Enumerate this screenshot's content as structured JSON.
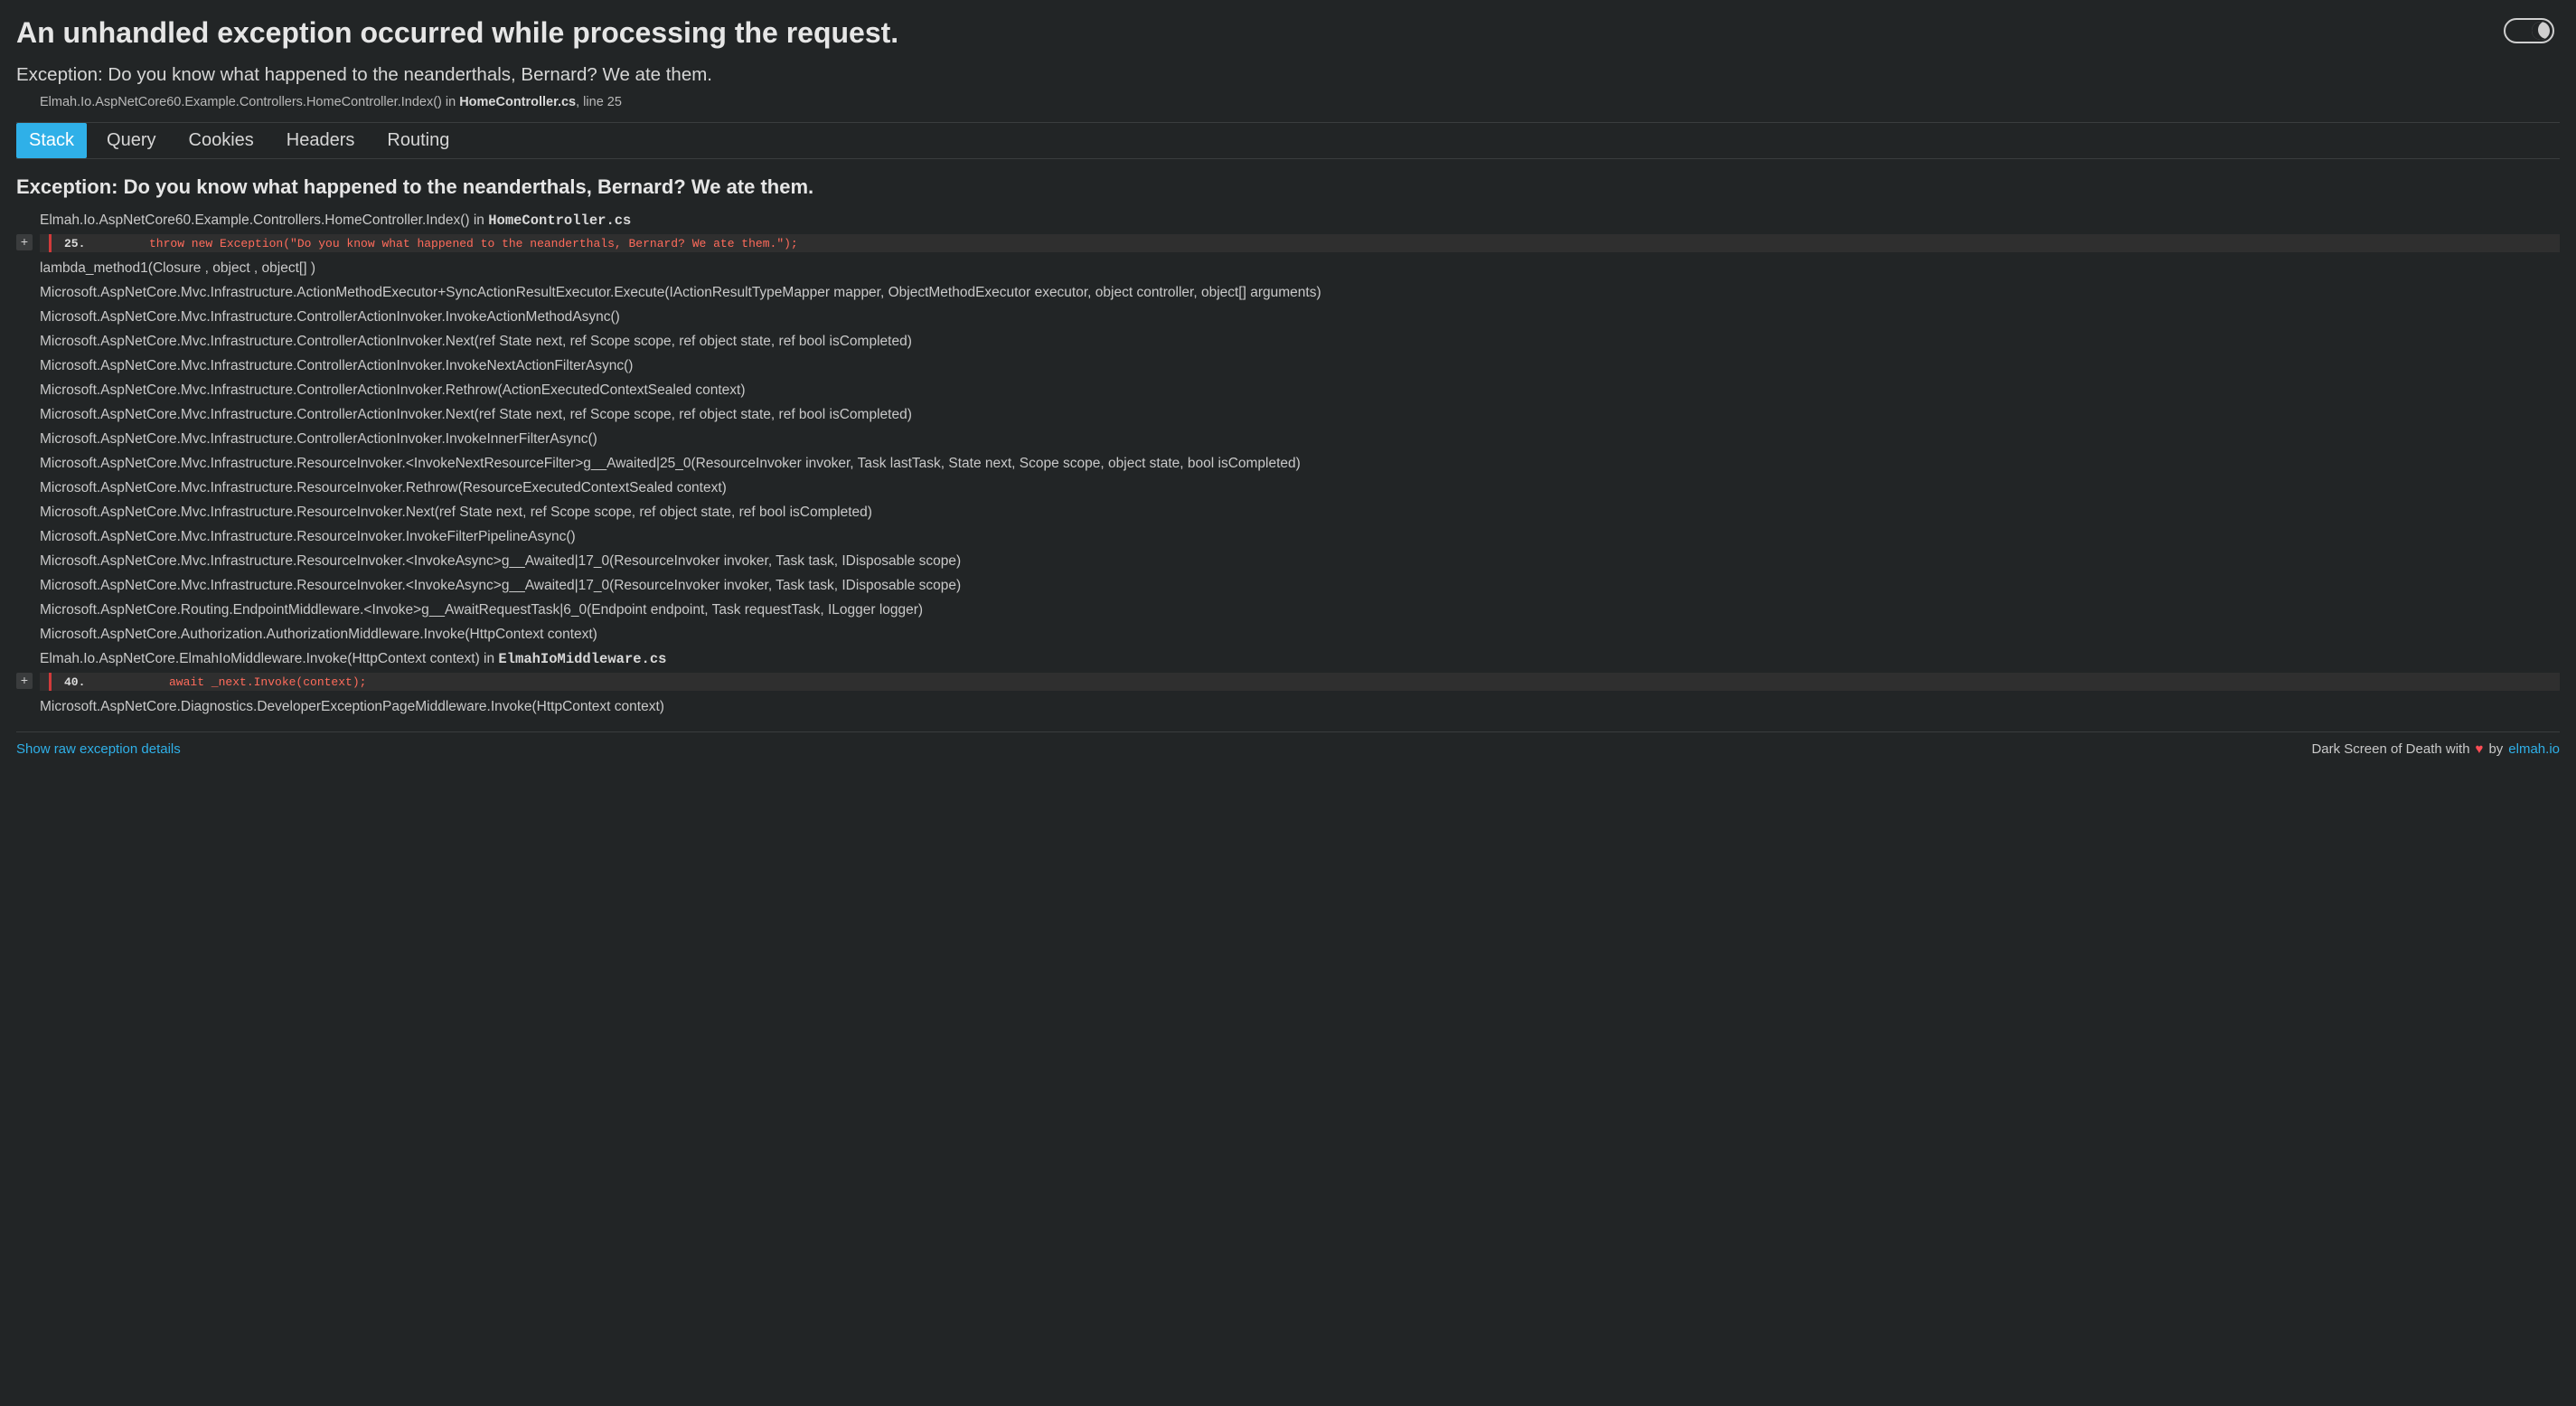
{
  "title": "An unhandled exception occurred while processing the request.",
  "summary": {
    "message": "Exception: Do you know what happened to the neanderthals, Bernard? We ate them.",
    "trace_prefix": "Elmah.Io.AspNetCore60.Example.Controllers.HomeController.Index() in ",
    "trace_file": "HomeController.cs",
    "trace_suffix": ", line 25"
  },
  "tabs": [
    "Stack",
    "Query",
    "Cookies",
    "Headers",
    "Routing"
  ],
  "active_tab": "Stack",
  "exception_heading": "Exception: Do you know what happened to the neanderthals, Bernard? We ate them.",
  "expand_glyph": "+",
  "code1": {
    "frame_prefix": "Elmah.Io.AspNetCore60.Example.Controllers.HomeController.Index() in ",
    "frame_file": "HomeController.cs",
    "lineno": "25.",
    "code": "throw new Exception(\"Do you know what happened to the neanderthals, Bernard? We ate them.\");"
  },
  "frames_mid": [
    "lambda_method1(Closure , object , object[] )",
    "Microsoft.AspNetCore.Mvc.Infrastructure.ActionMethodExecutor+SyncActionResultExecutor.Execute(IActionResultTypeMapper mapper, ObjectMethodExecutor executor, object controller, object[] arguments)",
    "Microsoft.AspNetCore.Mvc.Infrastructure.ControllerActionInvoker.InvokeActionMethodAsync()",
    "Microsoft.AspNetCore.Mvc.Infrastructure.ControllerActionInvoker.Next(ref State next, ref Scope scope, ref object state, ref bool isCompleted)",
    "Microsoft.AspNetCore.Mvc.Infrastructure.ControllerActionInvoker.InvokeNextActionFilterAsync()",
    "Microsoft.AspNetCore.Mvc.Infrastructure.ControllerActionInvoker.Rethrow(ActionExecutedContextSealed context)",
    "Microsoft.AspNetCore.Mvc.Infrastructure.ControllerActionInvoker.Next(ref State next, ref Scope scope, ref object state, ref bool isCompleted)",
    "Microsoft.AspNetCore.Mvc.Infrastructure.ControllerActionInvoker.InvokeInnerFilterAsync()",
    "Microsoft.AspNetCore.Mvc.Infrastructure.ResourceInvoker.<InvokeNextResourceFilter>g__Awaited|25_0(ResourceInvoker invoker, Task lastTask, State next, Scope scope, object state, bool isCompleted)",
    "Microsoft.AspNetCore.Mvc.Infrastructure.ResourceInvoker.Rethrow(ResourceExecutedContextSealed context)",
    "Microsoft.AspNetCore.Mvc.Infrastructure.ResourceInvoker.Next(ref State next, ref Scope scope, ref object state, ref bool isCompleted)",
    "Microsoft.AspNetCore.Mvc.Infrastructure.ResourceInvoker.InvokeFilterPipelineAsync()",
    "Microsoft.AspNetCore.Mvc.Infrastructure.ResourceInvoker.<InvokeAsync>g__Awaited|17_0(ResourceInvoker invoker, Task task, IDisposable scope)",
    "Microsoft.AspNetCore.Mvc.Infrastructure.ResourceInvoker.<InvokeAsync>g__Awaited|17_0(ResourceInvoker invoker, Task task, IDisposable scope)",
    "Microsoft.AspNetCore.Routing.EndpointMiddleware.<Invoke>g__AwaitRequestTask|6_0(Endpoint endpoint, Task requestTask, ILogger logger)",
    "Microsoft.AspNetCore.Authorization.AuthorizationMiddleware.Invoke(HttpContext context)"
  ],
  "code2": {
    "frame_prefix": "Elmah.Io.AspNetCore.ElmahIoMiddleware.Invoke(HttpContext context) in ",
    "frame_file": "ElmahIoMiddleware.cs",
    "lineno": "40.",
    "code": "await _next.Invoke(context);"
  },
  "frames_after": [
    "Microsoft.AspNetCore.Diagnostics.DeveloperExceptionPageMiddleware.Invoke(HttpContext context)"
  ],
  "footer": {
    "raw_link": "Show raw exception details",
    "credit_prefix": "Dark Screen of Death with",
    "credit_by": "by",
    "credit_link": "elmah.io"
  }
}
